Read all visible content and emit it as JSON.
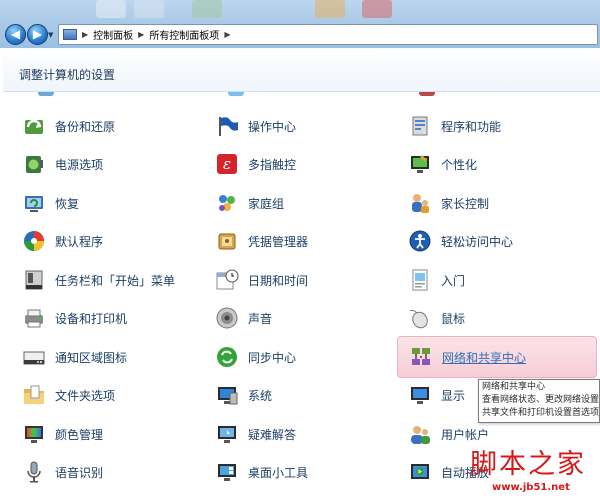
{
  "address_bar": {
    "crumbs": [
      "控制面板",
      "所有控制面板项"
    ]
  },
  "header": {
    "title": "调整计算机的设置"
  },
  "columns": [
    {
      "items": [
        {
          "label": "备份和还原",
          "icon": "backup-restore-icon"
        },
        {
          "label": "电源选项",
          "icon": "power-options-icon"
        },
        {
          "label": "恢复",
          "icon": "recovery-icon"
        },
        {
          "label": "默认程序",
          "icon": "default-programs-icon"
        },
        {
          "label": "任务栏和「开始」菜单",
          "icon": "taskbar-start-menu-icon"
        },
        {
          "label": "设备和打印机",
          "icon": "devices-printers-icon"
        },
        {
          "label": "通知区域图标",
          "icon": "notification-area-icon"
        },
        {
          "label": "文件夹选项",
          "icon": "folder-options-icon"
        },
        {
          "label": "颜色管理",
          "icon": "color-management-icon"
        },
        {
          "label": "语音识别",
          "icon": "speech-recognition-icon"
        }
      ]
    },
    {
      "items": [
        {
          "label": "操作中心",
          "icon": "action-center-icon"
        },
        {
          "label": "多指触控",
          "icon": "multi-touch-icon"
        },
        {
          "label": "家庭组",
          "icon": "homegroup-icon"
        },
        {
          "label": "凭据管理器",
          "icon": "credential-manager-icon"
        },
        {
          "label": "日期和时间",
          "icon": "date-time-icon"
        },
        {
          "label": "声音",
          "icon": "sound-icon"
        },
        {
          "label": "同步中心",
          "icon": "sync-center-icon"
        },
        {
          "label": "系统",
          "icon": "system-icon"
        },
        {
          "label": "疑难解答",
          "icon": "troubleshooting-icon"
        },
        {
          "label": "桌面小工具",
          "icon": "desktop-gadgets-icon"
        }
      ]
    },
    {
      "items": [
        {
          "label": "程序和功能",
          "icon": "programs-features-icon"
        },
        {
          "label": "个性化",
          "icon": "personalization-icon"
        },
        {
          "label": "家长控制",
          "icon": "parental-controls-icon"
        },
        {
          "label": "轻松访问中心",
          "icon": "ease-of-access-icon"
        },
        {
          "label": "入门",
          "icon": "getting-started-icon"
        },
        {
          "label": "鼠标",
          "icon": "mouse-icon"
        },
        {
          "label": "网络和共享中心",
          "icon": "network-sharing-icon",
          "hovered": true
        },
        {
          "label": "显示",
          "icon": "display-icon"
        },
        {
          "label": "用户帐户",
          "icon": "user-accounts-icon"
        },
        {
          "label": "自动播放",
          "icon": "autoplay-icon"
        }
      ]
    }
  ],
  "tooltip": {
    "line1": "网络和共享中心",
    "line2": "查看网络状态、更改网络设置",
    "line3": "共享文件和打印机设置首选项"
  },
  "watermark": {
    "text": "脚本之家",
    "url": "www.jb51.net"
  },
  "colors": {
    "link_text": "#1c3f66",
    "hover_bg": "#f6cdd6",
    "watermark": "#d81818"
  }
}
